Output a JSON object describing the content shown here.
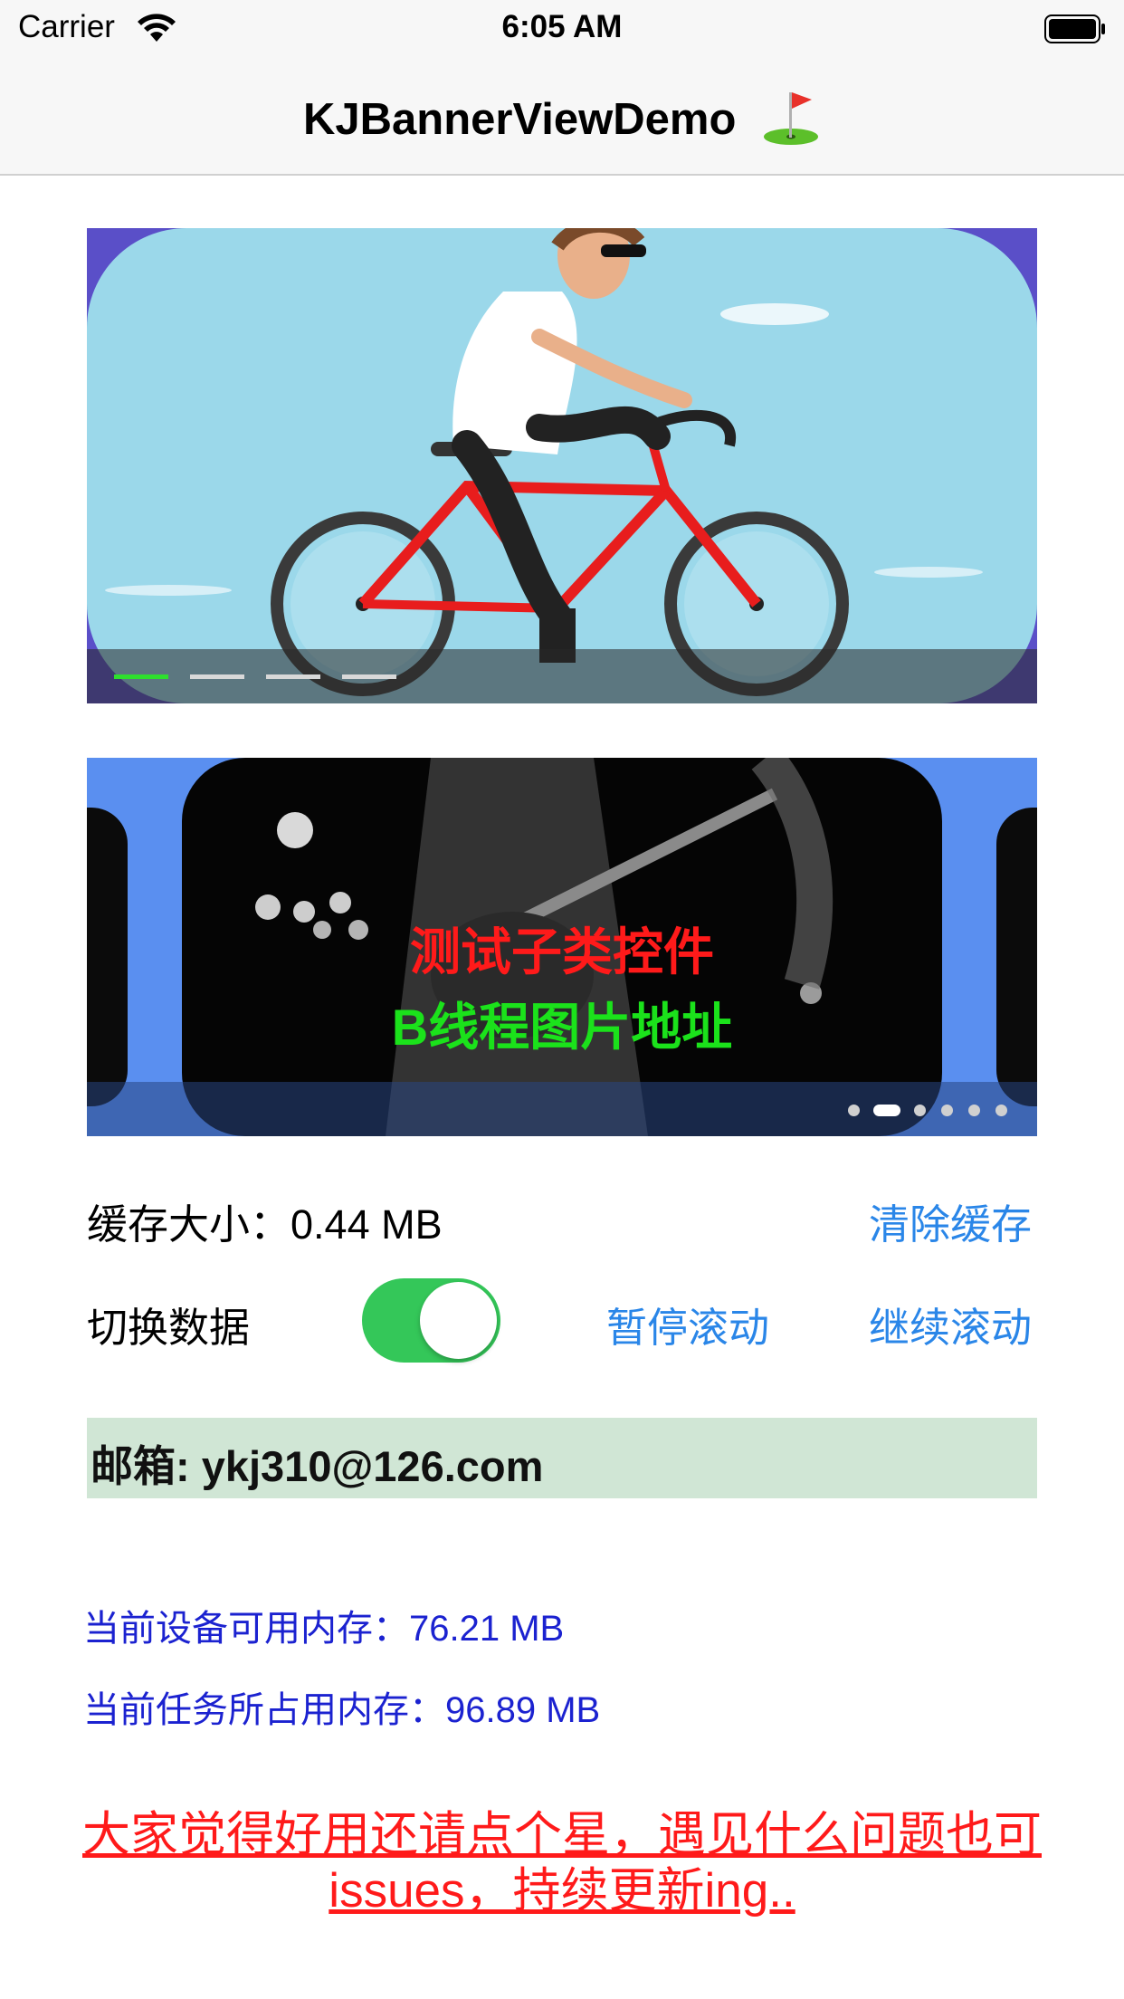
{
  "status_bar": {
    "carrier": "Carrier",
    "time": "6:05 AM"
  },
  "nav": {
    "title": "KJBannerViewDemo",
    "title_icon": "golf-flag-icon"
  },
  "banner1": {
    "page_count": 4,
    "current_page": 1,
    "image": "cyclist-illustration"
  },
  "banner2": {
    "text_line1": "测试子类控件",
    "text_line2": "B线程图片地址",
    "page_count": 6,
    "current_page": 2,
    "image": "guitarist-photo"
  },
  "cache": {
    "label": "缓存大小：",
    "value": "0.44 MB",
    "clear_button": "清除缓存"
  },
  "controls": {
    "switch_label": "切换数据",
    "switch_on": true,
    "pause_button": "暂停滚动",
    "resume_button": "继续滚动"
  },
  "email": {
    "text": "邮箱: ykj310@126.com"
  },
  "memory": {
    "available_label": "当前设备可用内存：",
    "available_value": "76.21 MB",
    "used_label": "当前任务所占用内存：",
    "used_value": "96.89 MB"
  },
  "footer": {
    "line1": "大家觉得好用还请点个星，遇见什么问题也可",
    "line2": "issues，持续更新ing.."
  },
  "colors": {
    "switch_on": "#34c759",
    "link": "#2a86e8",
    "memory_text": "#1b22d0",
    "footer_text": "#ff1a1a",
    "email_bg": "#d0e6d5"
  }
}
